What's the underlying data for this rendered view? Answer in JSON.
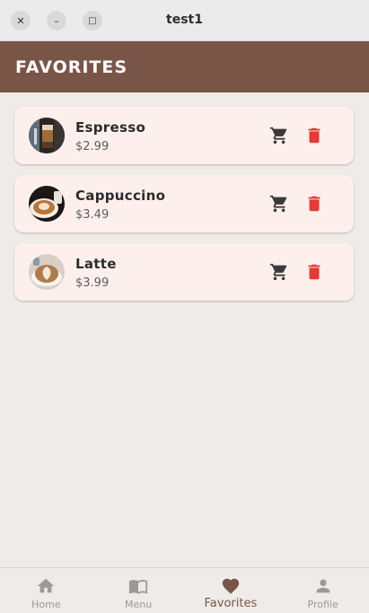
{
  "window": {
    "title": "test1",
    "close_glyph": "✕",
    "minimize_glyph": "–",
    "maximize_glyph": "□"
  },
  "appbar": {
    "title": "FAVORITES",
    "background": "#795548"
  },
  "favorites": [
    {
      "name": "Espresso",
      "price": "$2.99",
      "image": "espresso-photo"
    },
    {
      "name": "Cappuccino",
      "price": "$3.49",
      "image": "cappuccino-photo"
    },
    {
      "name": "Latte",
      "price": "$3.99",
      "image": "latte-photo"
    }
  ],
  "icons": {
    "cart": "cart-icon",
    "delete": "trash-icon"
  },
  "colors": {
    "accent": "#795548",
    "delete": "#e53935",
    "card_bg": "#fdf0ec",
    "page_bg": "#efebe9"
  },
  "bottom_nav": {
    "items": [
      {
        "label": "Home",
        "icon": "home-icon"
      },
      {
        "label": "Menu",
        "icon": "book-icon"
      },
      {
        "label": "Favorites",
        "icon": "heart-icon",
        "active": true
      },
      {
        "label": "Profile",
        "icon": "person-icon"
      }
    ]
  }
}
